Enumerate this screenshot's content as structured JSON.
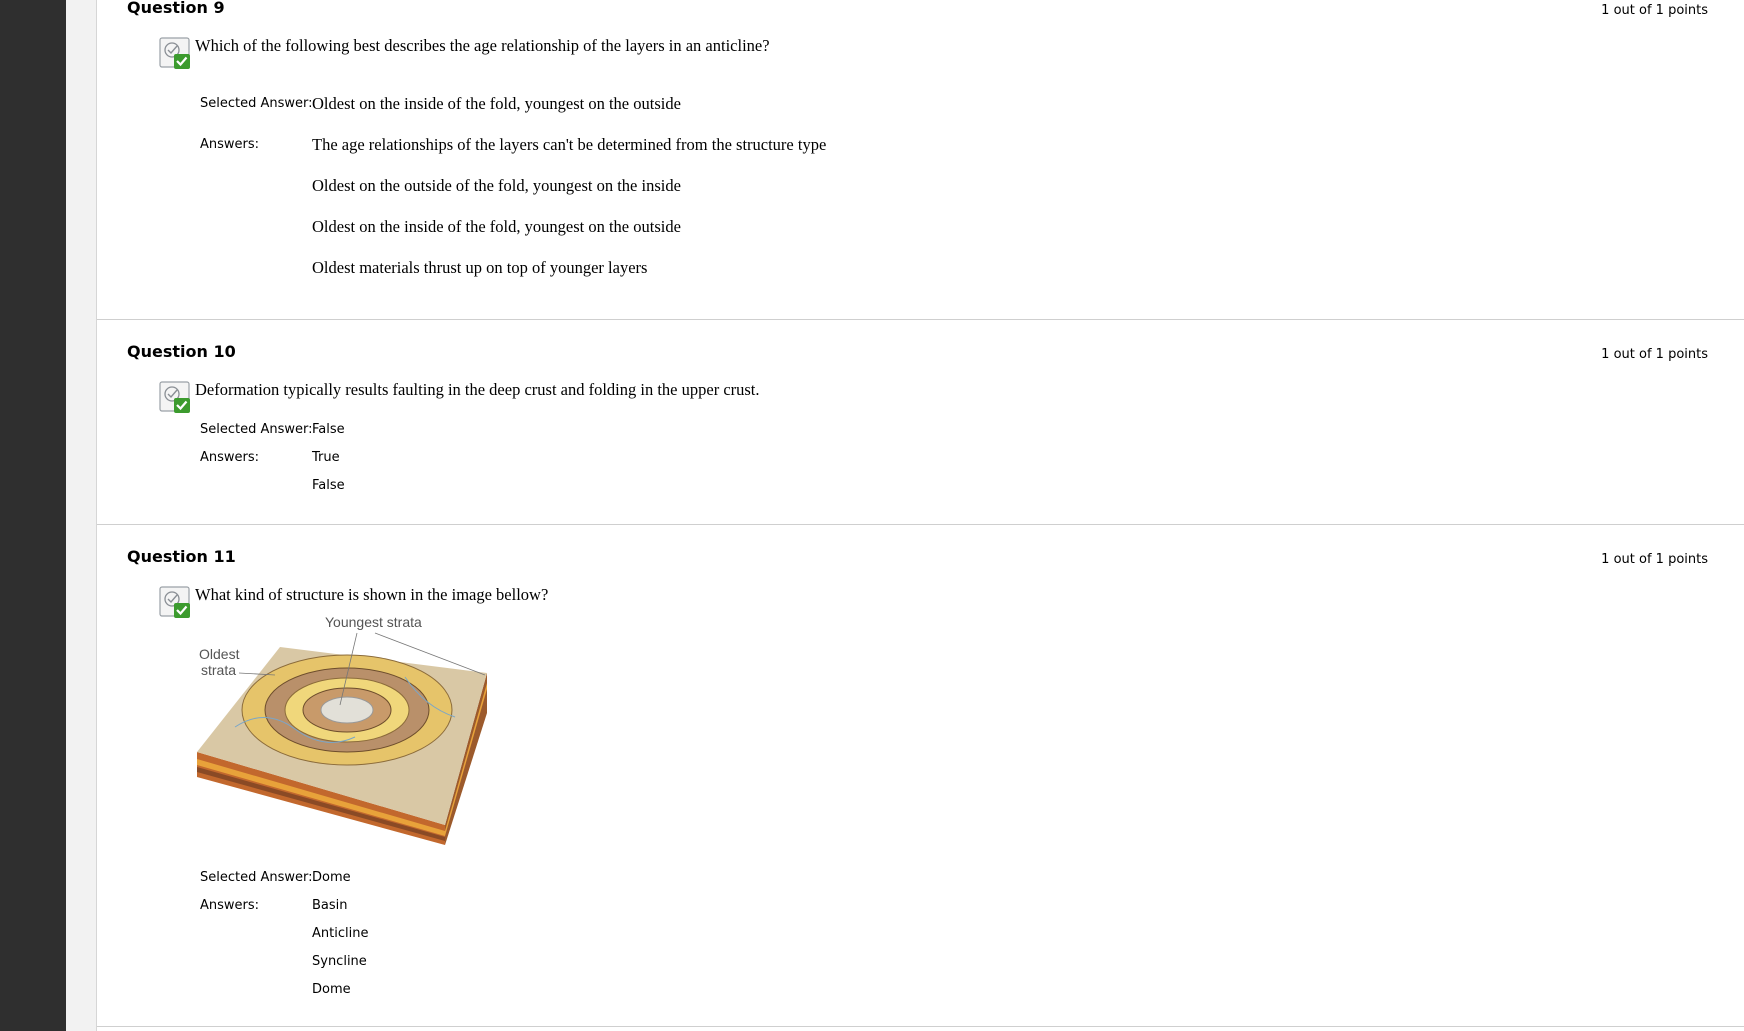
{
  "questions": [
    {
      "title": "Question 9",
      "points": "1 out of 1 points",
      "text": "Which of the following best describes the age relationship of the layers in an anticline?",
      "selected_label": "Selected Answer:",
      "selected_answer": "Oldest on the inside of the fold, youngest on the outside",
      "answers_label": "Answers:",
      "answers": [
        "The age relationships of the layers can't be determined from the structure type",
        "Oldest on the outside of the fold, youngest on the inside",
        "Oldest on the inside of the fold, youngest on the outside",
        "Oldest materials thrust up on top of younger layers"
      ]
    },
    {
      "title": "Question 10",
      "points": "1 out of 1 points",
      "text": "Deformation typically results faulting in the deep crust and folding in the upper crust.",
      "selected_label": "Selected Answer:",
      "selected_answer": "False",
      "answers_label": "Answers:",
      "answers": [
        "True",
        "False"
      ]
    },
    {
      "title": "Question 11",
      "points": "1 out of 1 points",
      "text": "What kind of structure is shown in the image bellow?",
      "figure": {
        "label_top": "Youngest strata",
        "label_left_1": "Oldest",
        "label_left_2": "strata"
      },
      "selected_label": "Selected Answer:",
      "selected_answer": "Dome",
      "answers_label": "Answers:",
      "answers": [
        "Basin",
        "Anticline",
        "Syncline",
        "Dome"
      ]
    }
  ],
  "colors": {
    "correct_check": "#3c9b2e",
    "rail": "#2f2f2f",
    "divider": "#cfcfcf"
  }
}
